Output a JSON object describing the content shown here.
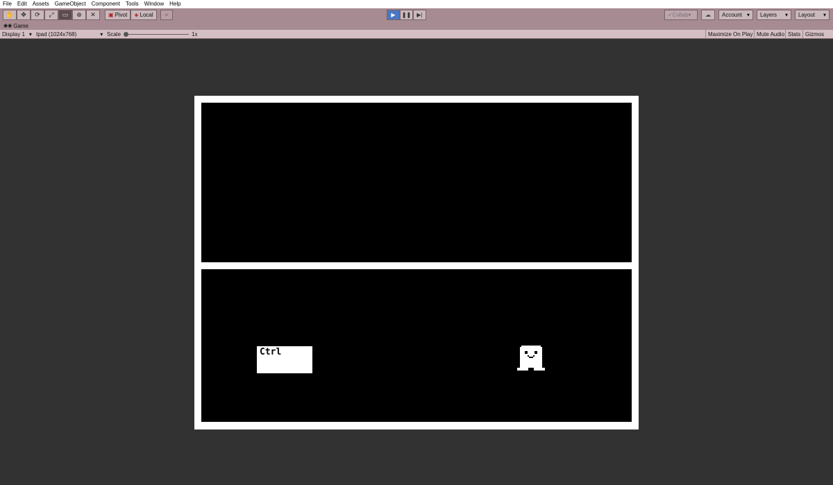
{
  "menu": [
    "File",
    "Edit",
    "Assets",
    "GameObject",
    "Component",
    "Tools",
    "Window",
    "Help"
  ],
  "toolbar": {
    "pivot_label": "Pivot",
    "local_label": "Local",
    "collab_label": "Collab",
    "account_label": "Account",
    "layers_label": "Layers",
    "layout_label": "Layout"
  },
  "tab": {
    "label": "Game"
  },
  "gamebar": {
    "display": "Display 1",
    "resolution": "Ipad (1024x768)",
    "scale_label": "Scale",
    "scale_value": "1x",
    "maximize": "Maximize On Play",
    "mute": "Mute Audio",
    "stats": "Stats",
    "gizmos": "Gizmos"
  },
  "game": {
    "ctrl_key_label": "Ctrl"
  },
  "colors": {
    "editor_tint": "#a68b93",
    "game_bg": "#000000",
    "frame": "#ffffff",
    "viewport_bg": "#323232",
    "play_active": "#4a78c2"
  }
}
